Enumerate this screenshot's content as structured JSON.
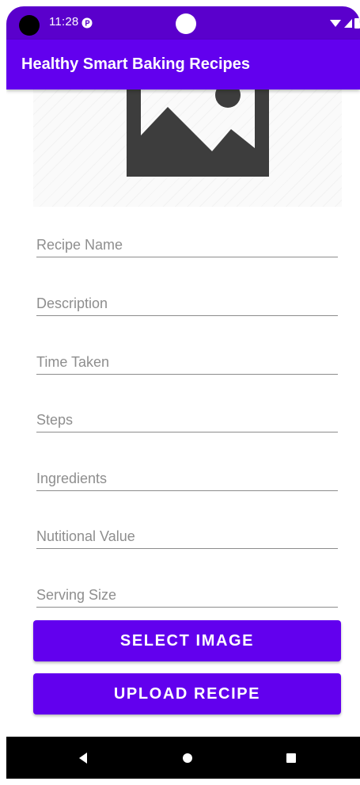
{
  "status_bar": {
    "time": "11:28",
    "icons": [
      "app-notification-icon",
      "wifi-icon",
      "signal-icon",
      "battery-icon"
    ]
  },
  "app_bar": {
    "title": "Healthy Smart Baking Recipes"
  },
  "image_preview": {
    "icon": "image-placeholder-icon"
  },
  "form": {
    "fields": [
      {
        "placeholder": "Recipe Name",
        "value": ""
      },
      {
        "placeholder": "Description",
        "value": ""
      },
      {
        "placeholder": "Time Taken",
        "value": ""
      },
      {
        "placeholder": "Steps",
        "value": ""
      },
      {
        "placeholder": "Ingredients",
        "value": ""
      },
      {
        "placeholder": "Nutitional Value",
        "value": ""
      },
      {
        "placeholder": "Serving Size",
        "value": ""
      }
    ]
  },
  "buttons": {
    "select_image": "SELECT IMAGE",
    "upload_recipe": "UPLOAD RECIPE"
  },
  "nav_bar": {
    "items": [
      "back-icon",
      "home-icon",
      "recents-icon"
    ]
  },
  "colors": {
    "primary": "#6200ee",
    "primary_dark": "#5a00cc",
    "field_underline": "#8c8c8c",
    "hint_text": "#8e8e8e"
  }
}
